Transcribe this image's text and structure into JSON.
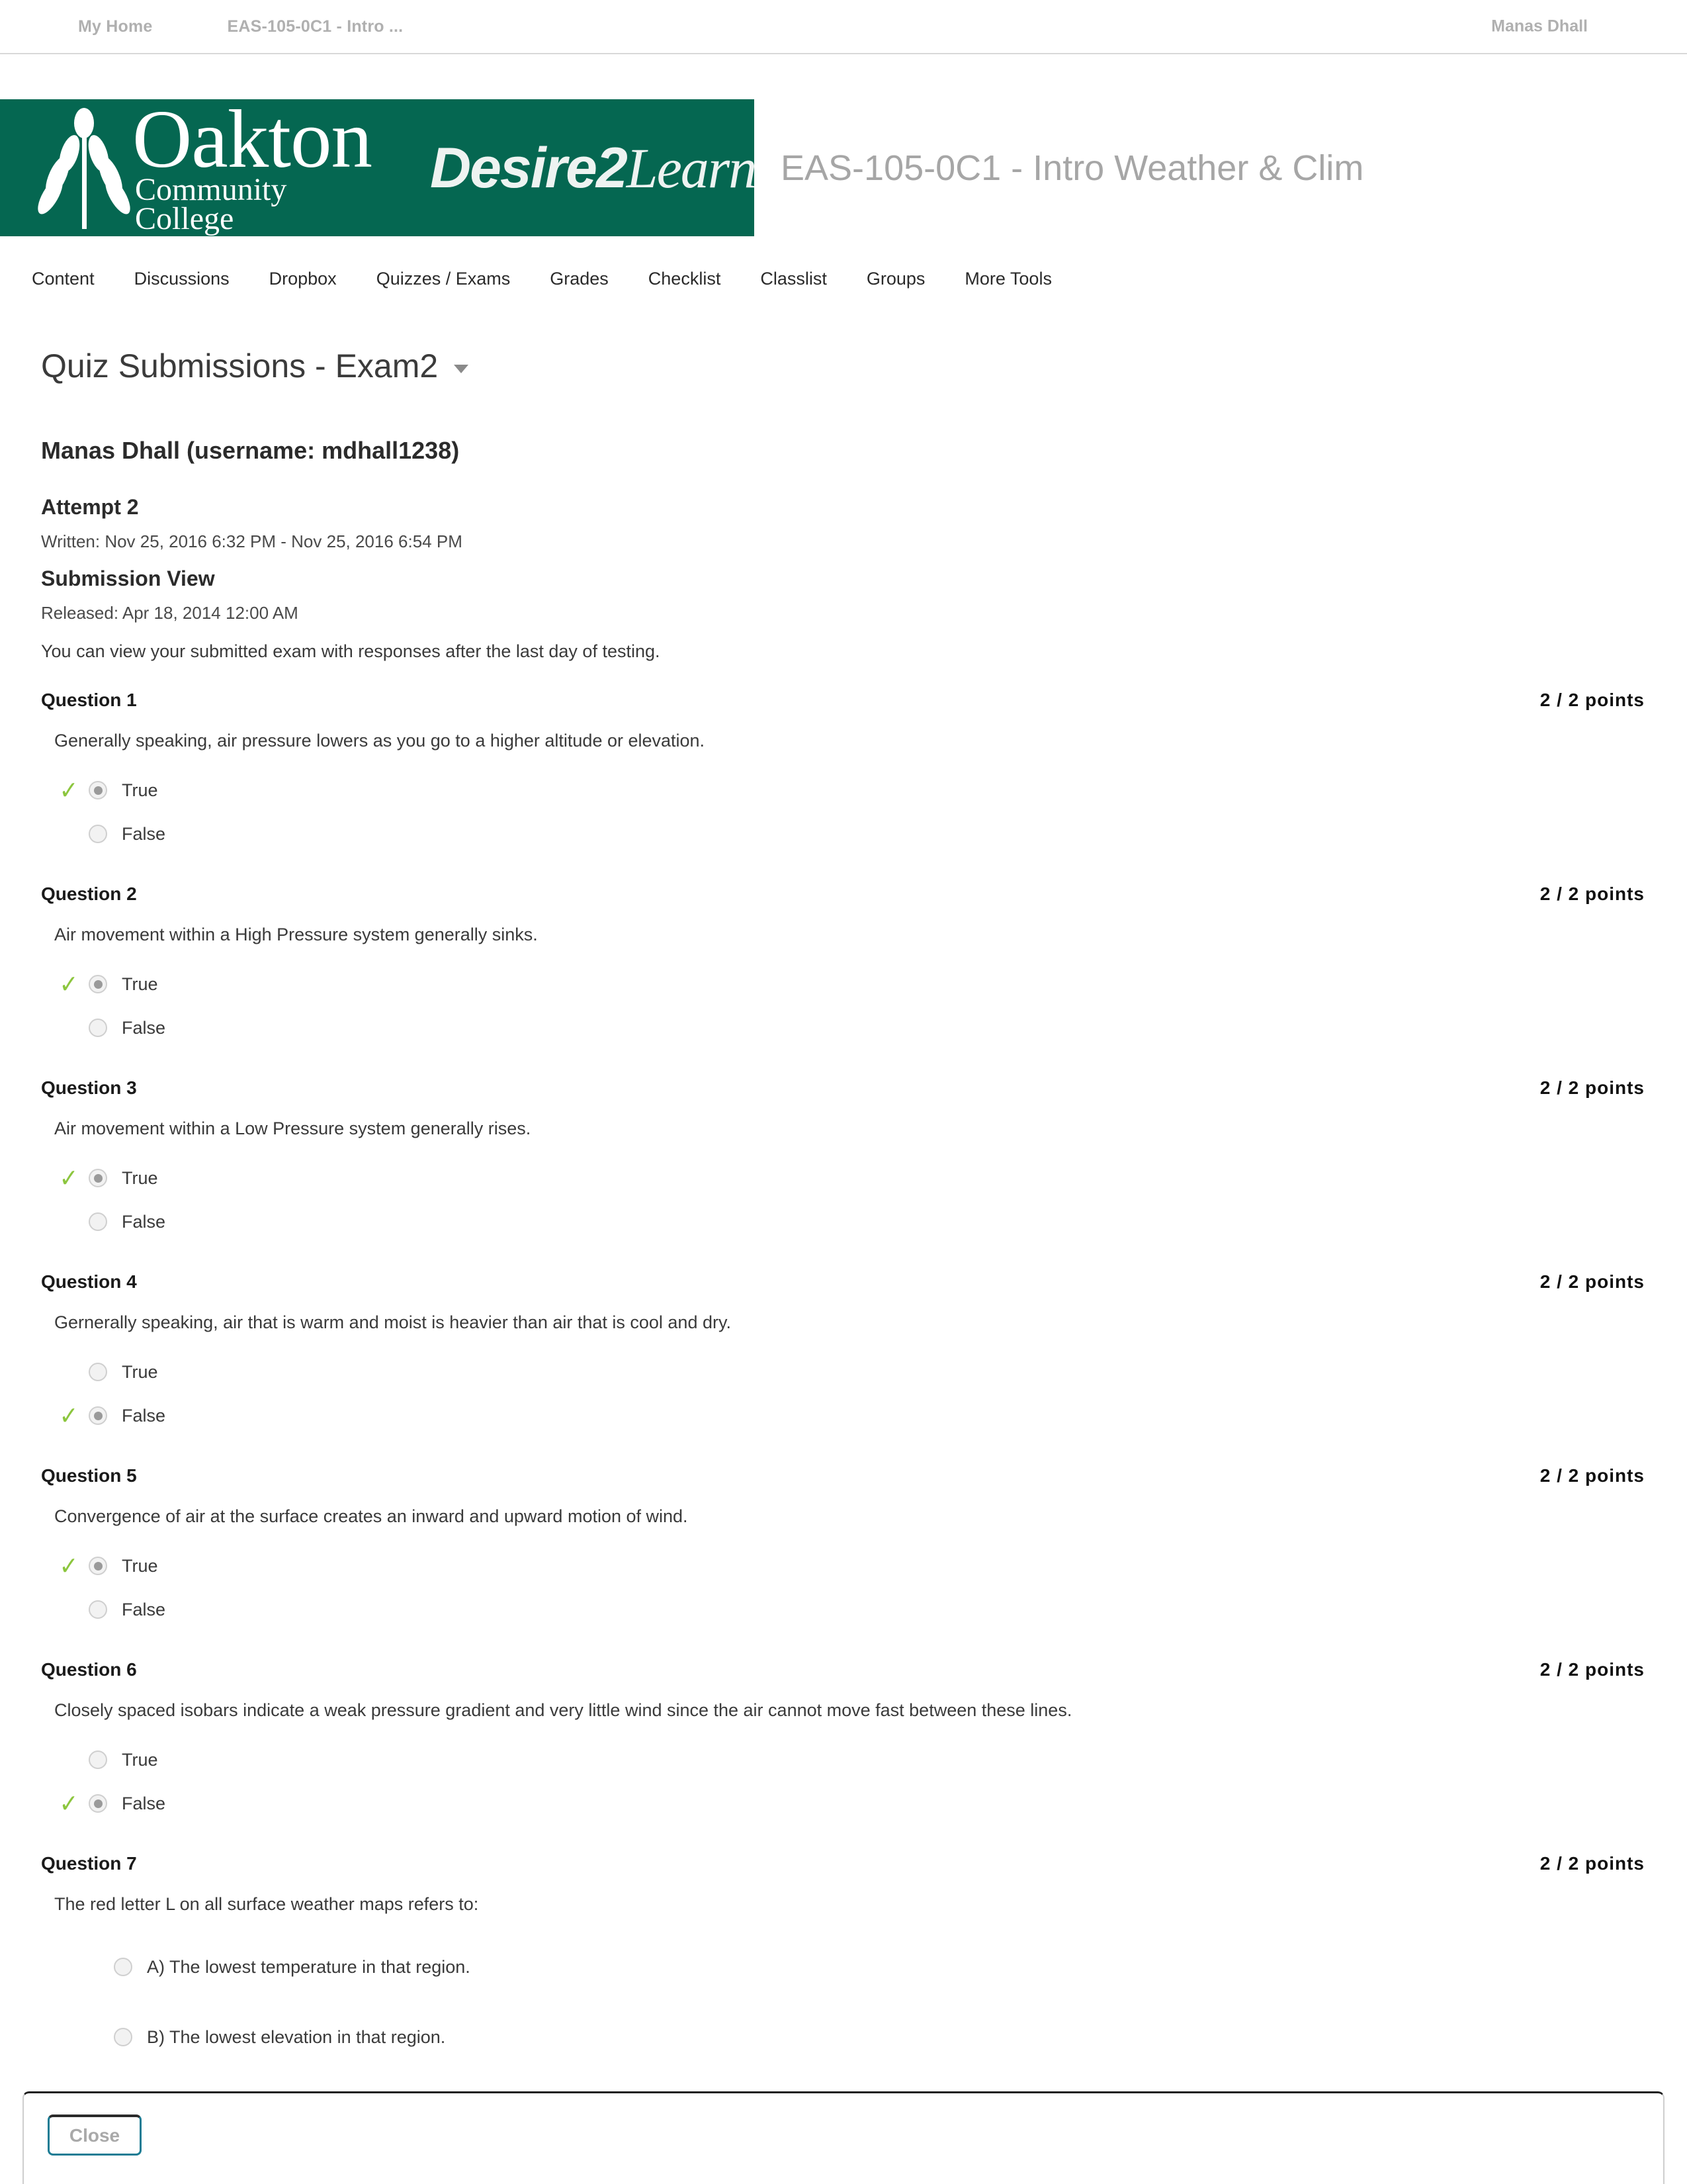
{
  "minibar": {
    "my_home": "My Home",
    "course_link": "EAS-105-0C1 - Intro ...",
    "user": "Manas Dhall"
  },
  "banner": {
    "logo_primary": "Oakton",
    "logo_secondary": "Community College",
    "d2l_bold": "Desire",
    "d2l_two": "2",
    "d2l_rest": "Learn",
    "registered_mark": "®",
    "course_title": "EAS-105-0C1 - Intro Weather & Clim",
    "banner_color": "#056751"
  },
  "navbar": {
    "items": [
      "Content",
      "Discussions",
      "Dropbox",
      "Quizzes / Exams",
      "Grades",
      "Checklist",
      "Classlist",
      "Groups",
      "More Tools"
    ]
  },
  "page": {
    "title": "Quiz Submissions - Exam2",
    "student": "Manas Dhall (username: mdhall1238)",
    "attempt_heading": "Attempt 2",
    "written": "Written: Nov 25, 2016 6:32 PM - Nov 25, 2016 6:54 PM",
    "submission_view_heading": "Submission View",
    "released": "Released: Apr 18, 2014 12:00 AM",
    "intro": "You can view your submitted exam with responses after the last day of testing."
  },
  "questions": [
    {
      "label": "Question 1",
      "points": "2 / 2 points",
      "text": "Generally speaking, air pressure lowers as you go to a higher altitude or elevation.",
      "type": "truefalse",
      "answers": [
        {
          "label": "True",
          "selected": true,
          "correct": true
        },
        {
          "label": "False",
          "selected": false,
          "correct": false
        }
      ]
    },
    {
      "label": "Question 2",
      "points": "2 / 2 points",
      "text": "Air movement within a High Pressure system generally sinks.",
      "type": "truefalse",
      "answers": [
        {
          "label": "True",
          "selected": true,
          "correct": true
        },
        {
          "label": "False",
          "selected": false,
          "correct": false
        }
      ]
    },
    {
      "label": "Question 3",
      "points": "2 / 2 points",
      "text": "Air movement within a Low Pressure system generally rises.",
      "type": "truefalse",
      "answers": [
        {
          "label": "True",
          "selected": true,
          "correct": true
        },
        {
          "label": "False",
          "selected": false,
          "correct": false
        }
      ]
    },
    {
      "label": "Question 4",
      "points": "2 / 2 points",
      "text": "Gernerally speaking, air that is warm and moist is heavier than air that is cool and dry.",
      "type": "truefalse",
      "answers": [
        {
          "label": "True",
          "selected": false,
          "correct": false
        },
        {
          "label": "False",
          "selected": true,
          "correct": true
        }
      ]
    },
    {
      "label": "Question 5",
      "points": "2 / 2 points",
      "text": "Convergence of air at the surface creates an inward and upward motion of wind.",
      "type": "truefalse",
      "answers": [
        {
          "label": "True",
          "selected": true,
          "correct": true
        },
        {
          "label": "False",
          "selected": false,
          "correct": false
        }
      ]
    },
    {
      "label": "Question 6",
      "points": "2 / 2 points",
      "text": "Closely spaced isobars indicate a weak pressure gradient and very little wind since the air cannot move fast between these lines.",
      "type": "truefalse",
      "answers": [
        {
          "label": "True",
          "selected": false,
          "correct": false
        },
        {
          "label": "False",
          "selected": true,
          "correct": true
        }
      ]
    },
    {
      "label": "Question 7",
      "points": "2 / 2 points",
      "text": "The red letter L on all surface weather maps refers to:",
      "type": "multiplechoice",
      "answers": [
        {
          "label": "A)  The lowest temperature in that region.",
          "selected": false,
          "correct": false
        },
        {
          "label": "B)  The lowest elevation in that region.",
          "selected": false,
          "correct": false
        }
      ]
    }
  ],
  "footer": {
    "close_label": "Close",
    "close_border_color": "#1b7c94"
  },
  "icons": {
    "check": "✓",
    "caret_down": "caret-down-icon"
  }
}
